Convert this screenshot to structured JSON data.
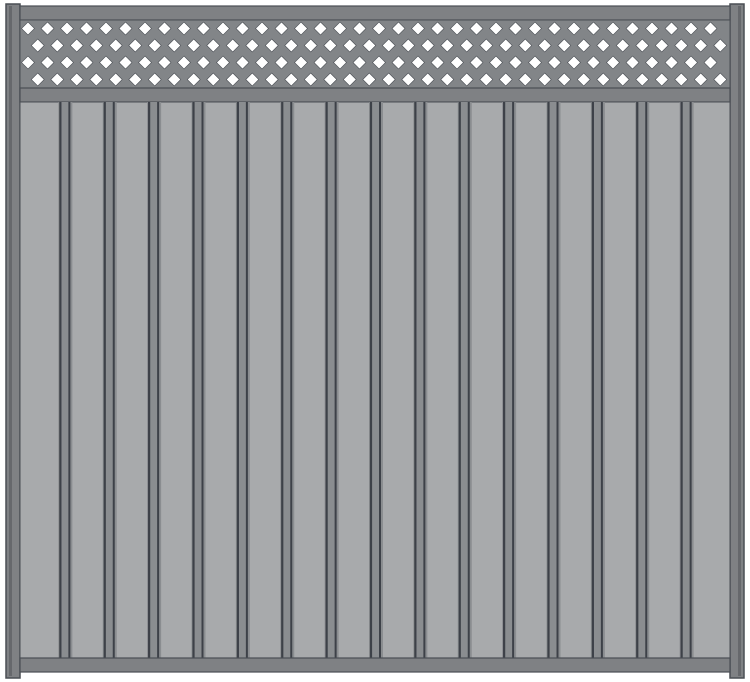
{
  "image": {
    "subject": "fence-panel",
    "colors": {
      "background": "#ffffff",
      "frame": "#7f8184",
      "frame_dark": "#55585c",
      "lattice": "#828588",
      "lattice_opening": "#ffffff",
      "board": "#a8aaac",
      "board_dark": "#8a8d90",
      "gap_shadow": "#3d4148",
      "outline": "#4a4e54"
    },
    "board_count": 16,
    "lattice_rows": 4
  }
}
